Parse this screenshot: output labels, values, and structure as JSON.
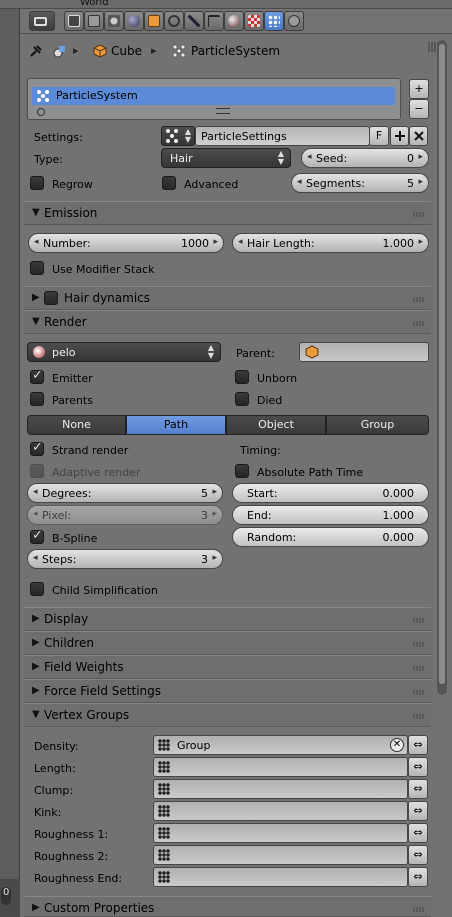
{
  "outliner": {
    "partial_text": "World"
  },
  "left_ruler": {
    "value": "0"
  },
  "header": {
    "editor_icon": "properties-editor-icon",
    "context_tabs": [
      "render-icon",
      "render-layers-icon",
      "scene-icon",
      "world-icon",
      "object-icon",
      "constraints-icon",
      "modifiers-icon",
      "data-icon",
      "material-icon",
      "texture-icon",
      "particles-icon",
      "physics-icon"
    ],
    "active_tab": "particles"
  },
  "breadcrumb": {
    "object": "Cube",
    "particle_system": "ParticleSystem"
  },
  "particle_list": {
    "items": [
      "ParticleSystem"
    ],
    "add_label": "+",
    "remove_label": "−"
  },
  "settings": {
    "settings_label": "Settings:",
    "settings_name": "ParticleSettings",
    "fake_user_label": "F",
    "type_label": "Type:",
    "type_value": "Hair",
    "seed_label": "Seed:",
    "seed_value": "0",
    "regrow_label": "Regrow",
    "advanced_label": "Advanced",
    "segments_label": "Segments:",
    "segments_value": "5"
  },
  "emission": {
    "title": "Emission",
    "number_label": "Number:",
    "number_value": "1000",
    "hair_length_label": "Hair Length:",
    "hair_length_value": "1.000",
    "modifier_stack_label": "Use Modifier Stack"
  },
  "hair_dynamics": {
    "title": "Hair dynamics"
  },
  "render": {
    "title": "Render",
    "material": "pelo",
    "parent_label": "Parent:",
    "emitter_label": "Emitter",
    "unborn_label": "Unborn",
    "parents_label": "Parents",
    "died_label": "Died",
    "modes": [
      "None",
      "Path",
      "Object",
      "Group"
    ],
    "active_mode": "Path",
    "strand_render_label": "Strand render",
    "timing_label": "Timing:",
    "adaptive_render_label": "Adaptive render",
    "absolute_path_time_label": "Absolute Path Time",
    "degrees_label": "Degrees:",
    "degrees_value": "5",
    "start_label": "Start:",
    "start_value": "0.000",
    "pixel_label": "Pixel:",
    "pixel_value": "3",
    "end_label": "End:",
    "end_value": "1.000",
    "bspline_label": "B-Spline",
    "random_label": "Random:",
    "random_value": "0.000",
    "steps_label": "Steps:",
    "steps_value": "3",
    "child_simplification_label": "Child Simplification"
  },
  "collapsed_panels": [
    "Display",
    "Children",
    "Field Weights",
    "Force Field Settings"
  ],
  "vertex_groups": {
    "title": "Vertex Groups",
    "rows": [
      {
        "label": "Density:",
        "value": "Group"
      },
      {
        "label": "Length:",
        "value": ""
      },
      {
        "label": "Clump:",
        "value": ""
      },
      {
        "label": "Kink:",
        "value": ""
      },
      {
        "label": "Roughness 1:",
        "value": ""
      },
      {
        "label": "Roughness 2:",
        "value": ""
      },
      {
        "label": "Roughness End:",
        "value": ""
      }
    ]
  },
  "custom_properties": {
    "title": "Custom Properties"
  },
  "colors": {
    "accent": "#5680cf",
    "panel_bg": "#727272",
    "selected_row": "#5a8ad8"
  }
}
